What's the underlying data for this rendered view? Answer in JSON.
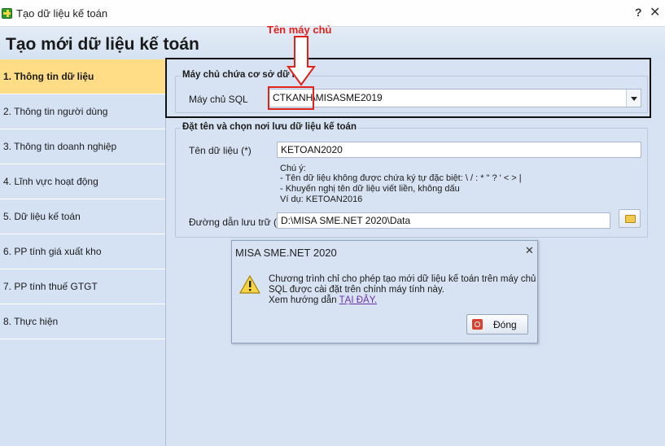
{
  "window": {
    "title": "Tạo dữ liệu kế toán",
    "help_glyph": "?",
    "close_glyph": "✕"
  },
  "header": {
    "title": "Tạo mới dữ liệu kế toán",
    "callout": "Tên máy chủ"
  },
  "sidebar": {
    "items": [
      {
        "label": "1. Thông tin dữ liệu",
        "active": true
      },
      {
        "label": "2. Thông tin người dùng"
      },
      {
        "label": "3. Thông tin doanh nghiệp"
      },
      {
        "label": "4. Lĩnh vực hoạt động"
      },
      {
        "label": "5. Dữ liệu kế toán"
      },
      {
        "label": "6. PP tính giá xuất kho"
      },
      {
        "label": "7. PP tính thuế GTGT"
      },
      {
        "label": "8. Thực hiện"
      }
    ]
  },
  "server_group": {
    "legend": "Máy chủ chứa cơ sở dữ liệu",
    "sql_label": "Máy chủ SQL",
    "sql_value": "CTKANH\\MISASME2019"
  },
  "data_group": {
    "legend": "Đặt tên và chọn nơi lưu dữ liệu kế toán",
    "name_label": "Tên dữ liệu (*)",
    "name_value": "KETOAN2020",
    "note_title": "Chú ý:",
    "note_1": "- Tên dữ liệu không được chứa ký tự đặc biệt: \\ / : * \" ? ' < > |",
    "note_2": "- Khuyến nghị tên dữ liệu viết liền, không dấu",
    "note_3": "Ví dụ: KETOAN2016",
    "path_label": "Đường dẫn lưu trữ (*)",
    "path_value": "D:\\MISA SME.NET 2020\\Data"
  },
  "dialog": {
    "title": "MISA SME.NET 2020",
    "close_glyph": "✕",
    "line_1": "Chương trình chỉ cho phép tạo mới dữ liệu kế toán trên máy chủ",
    "line_2": "SQL được cài đặt trên chính máy tính này.",
    "line_3_prefix": "Xem hướng dẫn ",
    "line_3_link": "TẠI ĐÂY.",
    "ok_label": "Đóng"
  },
  "colors": {
    "accent_active": "#fedd86",
    "panel_bg": "#d7e3f2",
    "annotation_red": "#e0221b",
    "link": "#6b2fa8"
  }
}
